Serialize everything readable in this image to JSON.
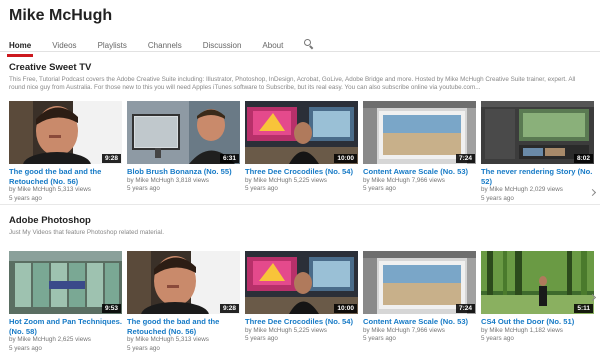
{
  "channel": {
    "name": "Mike McHugh"
  },
  "tabs": [
    {
      "label": "Home"
    },
    {
      "label": "Videos"
    },
    {
      "label": "Playlists"
    },
    {
      "label": "Channels"
    },
    {
      "label": "Discussion"
    },
    {
      "label": "About"
    }
  ],
  "sections": [
    {
      "title": "Creative Sweet TV",
      "description": "This Free, Tutorial Podcast covers the Adobe Creative Suite including: Illustrator, Photoshop, InDesign, Acrobat, GoLive, Adobe Bridge and more. Hosted by Mike McHugh Creative Suite trainer, expert. All round nice guy from Australia. For those new to this you will need Apples iTunes software to Subscribe, but its real easy. You can also subscribe online via youtube.com...",
      "videos": [
        {
          "title": "The good the bad and the Retouched (No. 56)",
          "meta": "by Mike McHugh  5,313 views",
          "age": "5 years ago",
          "duration": "9:28"
        },
        {
          "title": "Blob Brush Bonanza (No. 55)",
          "meta": "by Mike McHugh  3,818 views",
          "age": "5 years ago",
          "duration": "6:31"
        },
        {
          "title": "Three Dee Crocodiles (No. 54)",
          "meta": "by Mike McHugh  5,225 views",
          "age": "5 years ago",
          "duration": "10:00"
        },
        {
          "title": "Content Aware Scale (No. 53)",
          "meta": "by Mike McHugh  7,966 views",
          "age": "5 years ago",
          "duration": "7:24"
        },
        {
          "title": "The never rendering Story (No. 52)",
          "meta": "by Mike McHugh  2,029 views",
          "age": "5 years ago",
          "duration": "8:02"
        }
      ]
    },
    {
      "title": "Adobe Photoshop",
      "description": "Just My Videos that feature Photoshop related material.",
      "videos": [
        {
          "title": "Hot Zoom and Pan Techniques. (No. 58)",
          "meta": "by Mike McHugh  2,625 views",
          "age": "5 years ago",
          "duration": "9:53"
        },
        {
          "title": "The good the bad and the Retouched (No. 56)",
          "meta": "by Mike McHugh  5,313 views",
          "age": "5 years ago",
          "duration": "9:28"
        },
        {
          "title": "Three Dee Crocodiles (No. 54)",
          "meta": "by Mike McHugh  5,225 views",
          "age": "5 years ago",
          "duration": "10:00"
        },
        {
          "title": "Content Aware Scale (No. 53)",
          "meta": "by Mike McHugh  7,966 views",
          "age": "5 years ago",
          "duration": "7:24"
        },
        {
          "title": "CS4 Out the Door (No. 51)",
          "meta": "by Mike McHugh  1,182 views",
          "age": "5 years ago",
          "duration": "5:11"
        }
      ]
    }
  ],
  "colors": {
    "link": "#167ac6",
    "accent": "#cc181e"
  },
  "icons": {
    "search": "search-icon",
    "next": "chevron-right-icon"
  }
}
